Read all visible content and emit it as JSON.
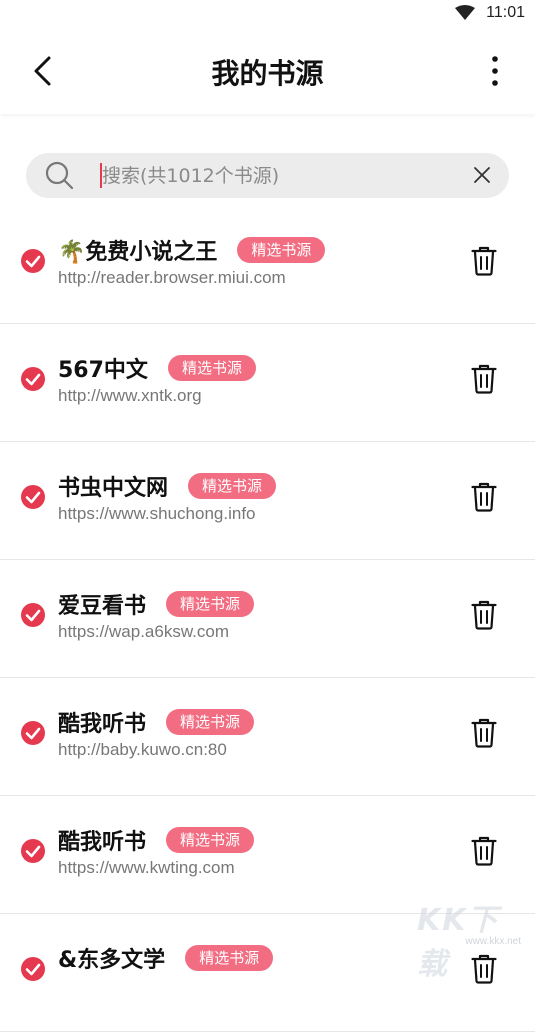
{
  "status_bar": {
    "time": "11:01"
  },
  "app_bar": {
    "title": "我的书源"
  },
  "search": {
    "placeholder": "搜索(共1012个书源)",
    "value": ""
  },
  "badge_label": "精选书源",
  "colors": {
    "accent": "#e53950",
    "badge": "#f26d82"
  },
  "sources": [
    {
      "name": "🌴免费小说之王",
      "url": "http://reader.browser.miui.com",
      "selected": true
    },
    {
      "name": "567中文",
      "url": "http://www.xntk.org",
      "selected": true
    },
    {
      "name": "书虫中文网",
      "url": "https://www.shuchong.info",
      "selected": true
    },
    {
      "name": "爱豆看书",
      "url": "https://wap.a6ksw.com",
      "selected": true
    },
    {
      "name": "酷我听书",
      "url": "http://baby.kuwo.cn:80",
      "selected": true
    },
    {
      "name": "酷我听书",
      "url": "https://www.kwting.com",
      "selected": true
    },
    {
      "name": "&东多文学",
      "url": "",
      "selected": true
    }
  ],
  "watermark": {
    "big": "KK下载",
    "small": "www.kkx.net"
  }
}
